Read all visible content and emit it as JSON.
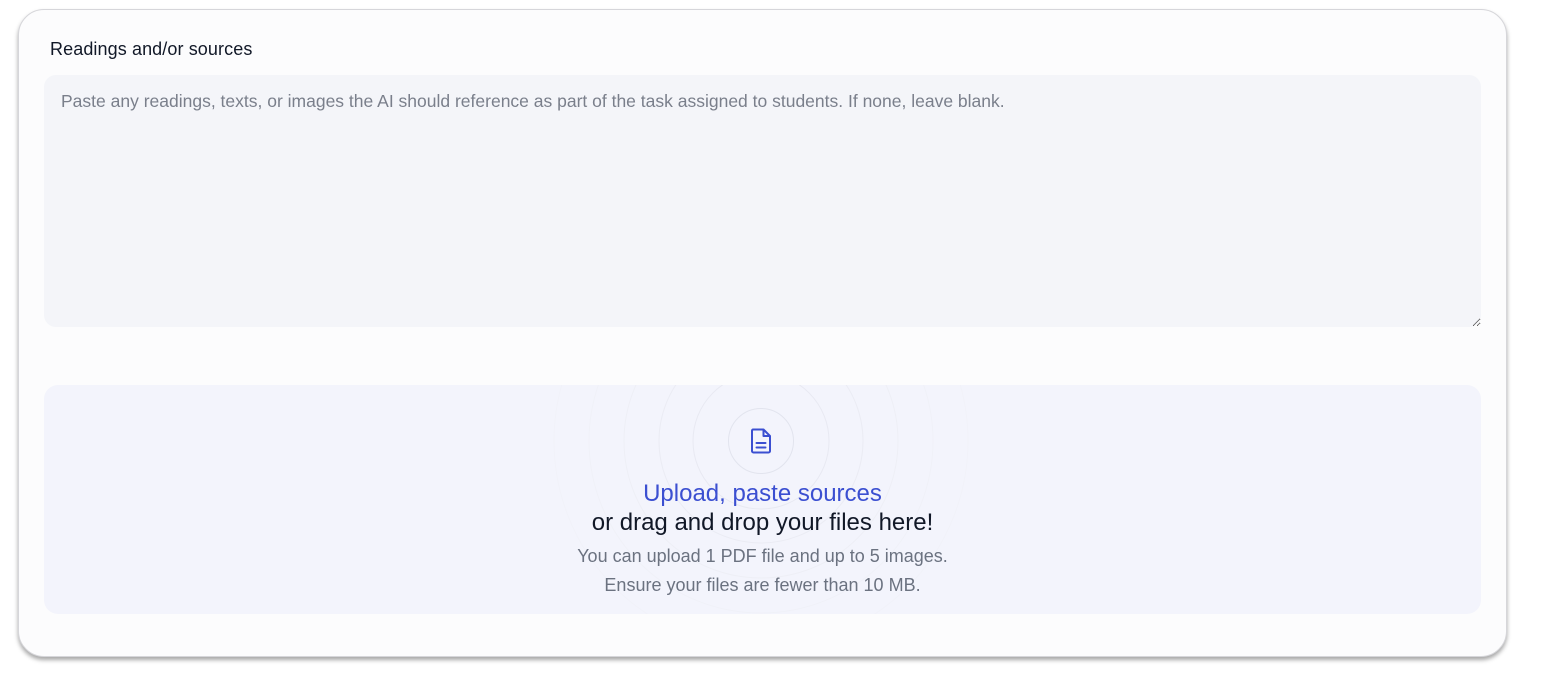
{
  "readings": {
    "label": "Readings and/or sources",
    "placeholder": "Paste any readings, texts, or images the AI should reference as part of the task assigned to students. If none, leave blank.",
    "value": ""
  },
  "upload": {
    "icon": "document-icon",
    "action_label": "Upload, paste sources",
    "drag_label": "or drag and drop your files here!",
    "hint_line_1": "You can upload 1 PDF file and up to 5 images.",
    "hint_line_2": "Ensure your files are fewer than 10 MB."
  },
  "colors": {
    "accent": "#3b4fd1",
    "text_primary": "#111827",
    "text_secondary": "#6b7280",
    "input_bg": "#f4f5f9",
    "dropzone_bg": "#f3f4fc"
  }
}
